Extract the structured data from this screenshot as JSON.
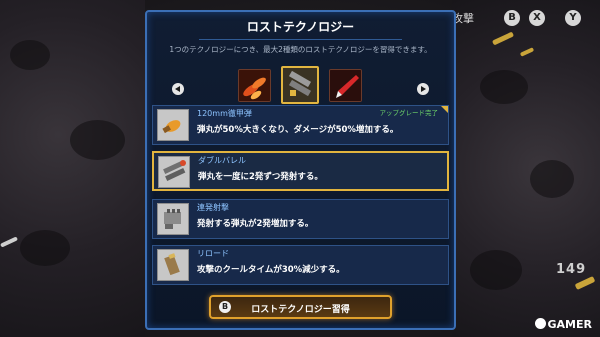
{
  "hud": {
    "attack_label": "攻撃",
    "buttons": [
      "B",
      "X",
      "Y"
    ],
    "counter": "149"
  },
  "watermark": "GAMER",
  "panel": {
    "title": "ロストテクノロジー",
    "subtitle": "1つのテクノロジーにつき、最大2種類のロストテクノロジーを習得できます。",
    "tech_icons": [
      "flame-shells-icon",
      "double-barrel-icon",
      "red-missile-icon"
    ],
    "selected_tech_index": 1
  },
  "rows": [
    {
      "name": "120mm徹甲弾",
      "desc": "弾丸が50%大きくなり、ダメージが50%増加する。",
      "badge": "アップグレード完了",
      "icon": "armor-piercing-shell-icon"
    },
    {
      "name": "ダブルバレル",
      "desc": "弾丸を一度に2発ずつ発射する。",
      "badge": "",
      "icon": "double-barrel-icon"
    },
    {
      "name": "連発射撃",
      "desc": "発射する弾丸が2発増加する。",
      "badge": "",
      "icon": "rapid-fire-icon"
    },
    {
      "name": "リロード",
      "desc": "攻撃のクールタイムが30%減少する。",
      "badge": "",
      "icon": "reload-magazine-icon"
    }
  ],
  "learn_button": {
    "key": "B",
    "label": "ロストテクノロジー習得"
  },
  "colors": {
    "panel_border": "#3b6fb6",
    "selected": "#e1b43e",
    "badge": "#6fd86a",
    "name": "#8ec4ff"
  }
}
